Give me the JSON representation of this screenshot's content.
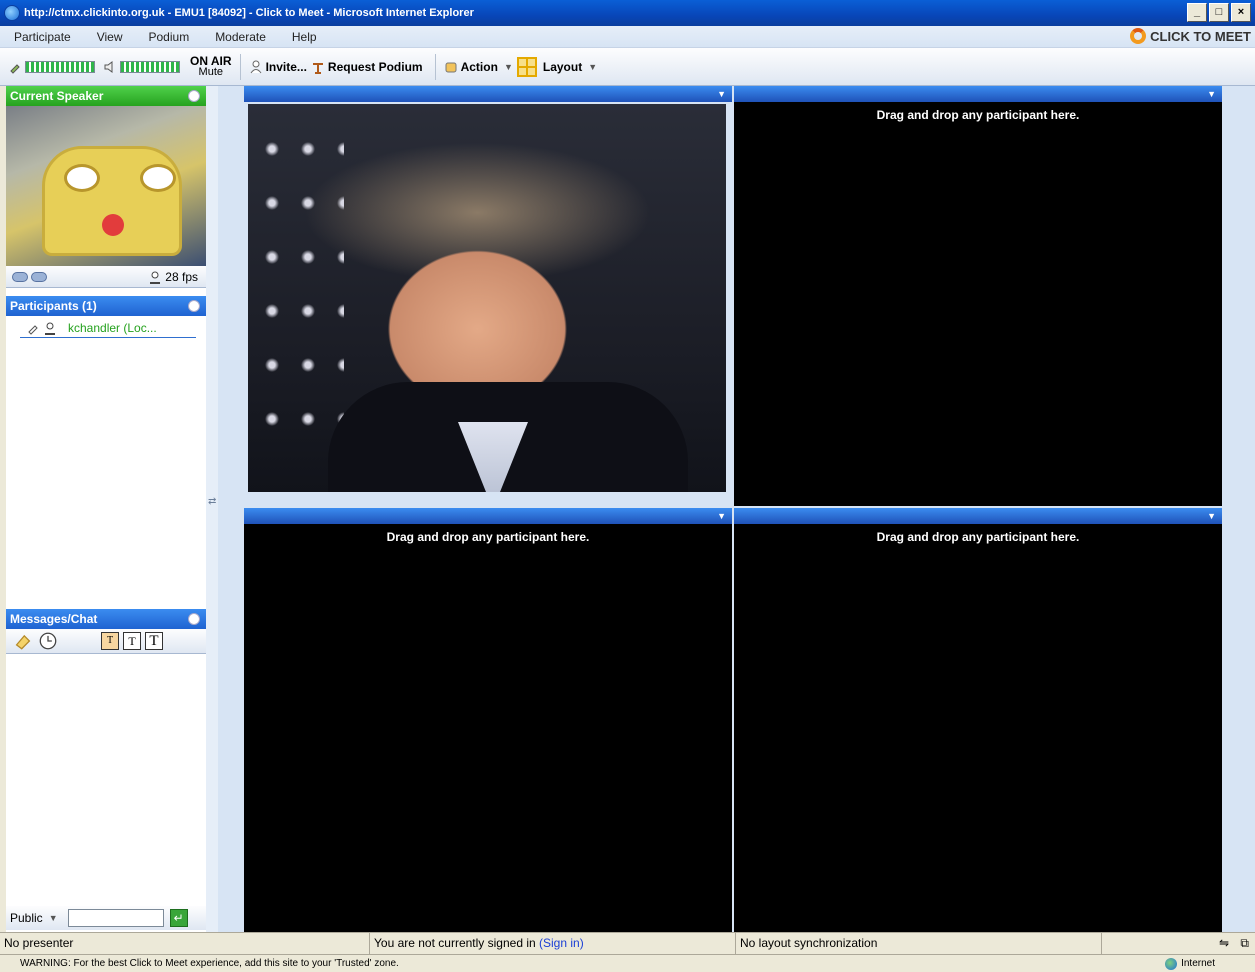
{
  "window": {
    "title": "http://ctmx.clickinto.org.uk - EMU1 [84092] - Click to Meet - Microsoft Internet Explorer"
  },
  "menu": {
    "items": [
      "Participate",
      "View",
      "Podium",
      "Moderate",
      "Help"
    ]
  },
  "brand": {
    "name": "CLICK TO MEET",
    "accent": "#f39a1e"
  },
  "toolbar": {
    "onair": "ON AIR",
    "mute": "Mute",
    "invite": "Invite...",
    "request_podium": "Request Podium",
    "action": "Action",
    "layout": "Layout"
  },
  "current_speaker": {
    "title": "Current Speaker",
    "fps": "28",
    "fps_unit": "fps"
  },
  "participants": {
    "title": "Participants (1)",
    "items": [
      {
        "name": "kchandler (Loc..."
      }
    ]
  },
  "chat": {
    "title": "Messages/Chat",
    "scope": "Public",
    "input_value": "",
    "send_label": "↵"
  },
  "video": {
    "drop_message": "Drag and drop any participant here."
  },
  "status": {
    "presenter": "No presenter",
    "signin_text": "You are not currently signed in",
    "signin_link": "(Sign in)",
    "layout_sync": "No layout synchronization"
  },
  "ie_status": {
    "warning": "WARNING: For the best Click to Meet experience, add this site to your 'Trusted' zone.",
    "zone": "Internet"
  },
  "colors": {
    "panel_blue": "#1f63d1",
    "speaker_green": "#26a21f",
    "participant_green": "#26a21f"
  }
}
